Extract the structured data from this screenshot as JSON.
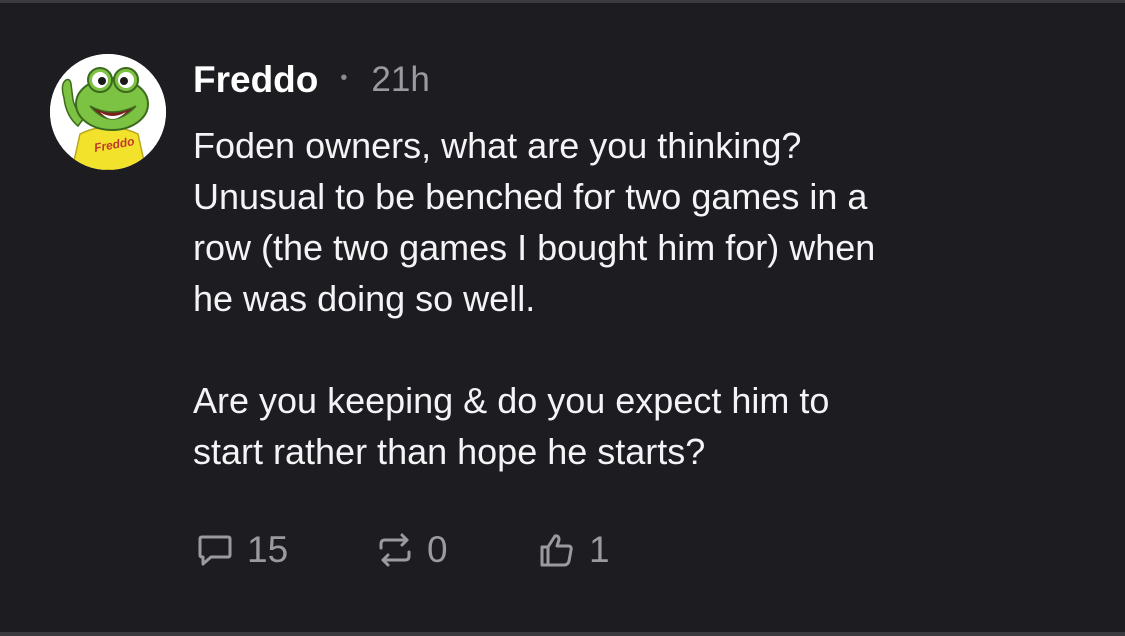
{
  "post": {
    "author": "Freddo",
    "separator": "•",
    "time": "21h",
    "avatar_text": "Freddo",
    "body": {
      "paragraph1_lines": [
        "Foden owners, what are you thinking?",
        "Unusual to be benched for two games in a",
        "row (the two games I bought him for) when",
        "he was doing so well."
      ],
      "paragraph2_lines": [
        "Are you keeping & do you expect him to",
        "start rather than hope he starts?"
      ]
    },
    "actions": {
      "replies": {
        "icon": "comment-icon",
        "count": "15"
      },
      "reposts": {
        "icon": "repost-icon",
        "count": "0"
      },
      "likes": {
        "icon": "thumbs-up-icon",
        "count": "1"
      }
    }
  },
  "colors": {
    "background": "#1d1d21",
    "text": "#ffffff",
    "muted": "#9a9aa1",
    "avatar_frog": "#7cc243",
    "avatar_shirt": "#f2e22c"
  }
}
